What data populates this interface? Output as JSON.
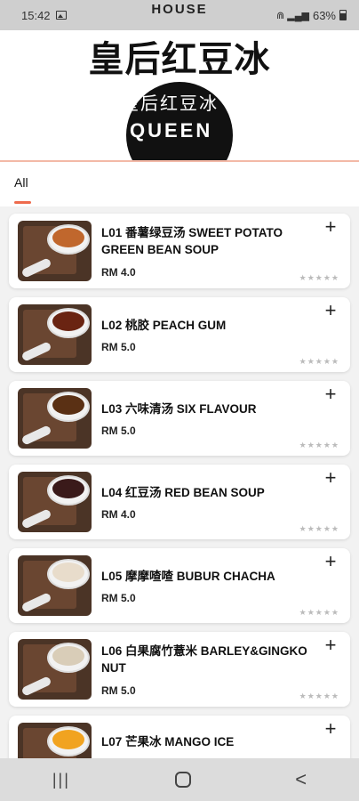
{
  "status_bar": {
    "time": "15:42",
    "signal_text": "⋒ ▂▄▆",
    "battery": "63%"
  },
  "header": {
    "brand_small": "HOUSE",
    "brand_title": "皇后红豆冰",
    "logo_text": "皇后红豆冰",
    "logo_sub": "QUEEN"
  },
  "tabs": {
    "all_label": "All"
  },
  "items": [
    {
      "name": "L01 番薯绿豆汤 SWEET POTATO GREEN BEAN SOUP",
      "price": "RM 4.0",
      "soup_color": "#c0672d",
      "rating": "★★★★★"
    },
    {
      "name": "L02 桃胶 PEACH GUM",
      "price": "RM 5.0",
      "soup_color": "#6a2412",
      "rating": "★★★★★"
    },
    {
      "name": "L03 六味清汤 SIX FLAVOUR",
      "price": "RM 5.0",
      "soup_color": "#5a3014",
      "rating": "★★★★★"
    },
    {
      "name": "L04 红豆汤 RED BEAN SOUP",
      "price": "RM 4.0",
      "soup_color": "#3a1a1a",
      "rating": "★★★★★"
    },
    {
      "name": "L05 摩摩喳喳 BUBUR CHACHA",
      "price": "RM 5.0",
      "soup_color": "#e8dccb",
      "rating": "★★★★★"
    },
    {
      "name": "L06 白果腐竹薏米 BARLEY&GINGKO NUT",
      "price": "RM 5.0",
      "soup_color": "#d9cdb8",
      "rating": "★★★★★"
    },
    {
      "name": "L07 芒果冰 MANGO ICE",
      "price": "",
      "soup_color": "#f1a320",
      "rating": ""
    }
  ],
  "colors": {
    "accent": "#ee6b4d",
    "header_line": "#f3b9a7"
  },
  "nav": {
    "recent": "|||",
    "back": "<"
  }
}
